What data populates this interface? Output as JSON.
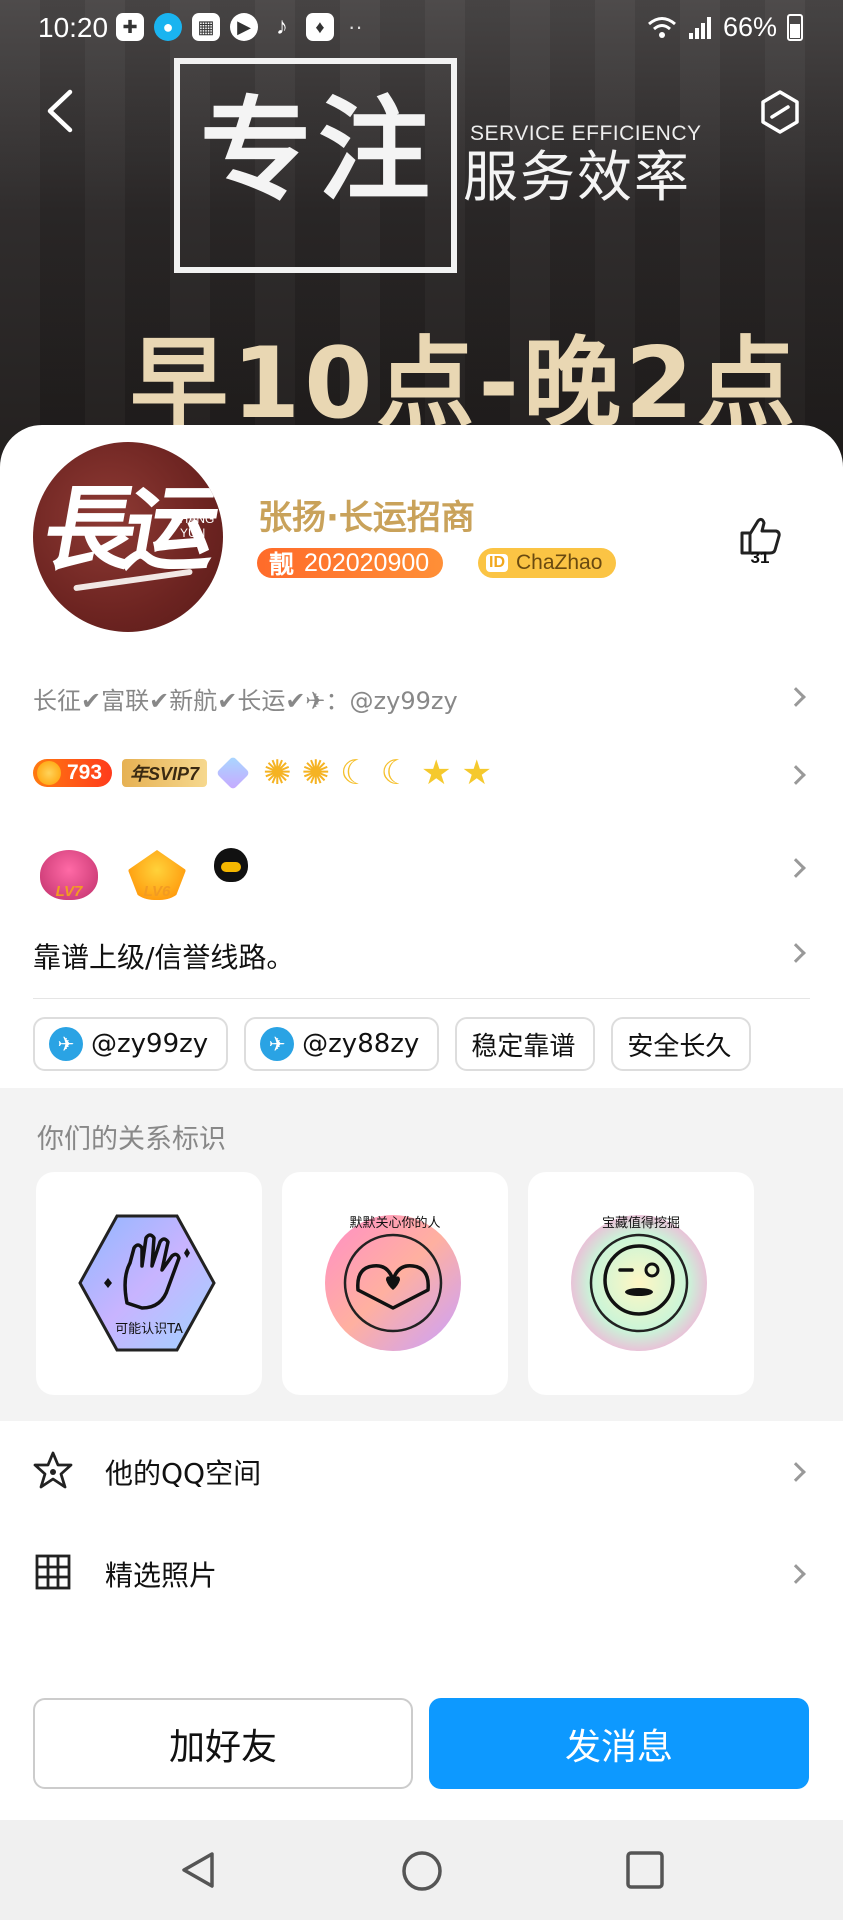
{
  "status_bar": {
    "time": "10:20",
    "battery": "66%",
    "more_dots": "··"
  },
  "banner": {
    "big_text": "专注",
    "subtitle_en": "SERVICE EFFICIENCY",
    "subtitle_cn": "服务效率",
    "hours_text": "早10点-晚2点"
  },
  "profile": {
    "avatar_text": "長运",
    "avatar_en": "CHANG\nYUN",
    "name": "张扬·长运招商",
    "liang_tag": "靓",
    "number": "202020900",
    "id_tag": "ID",
    "id_name": "ChaZhao",
    "like_count": "31"
  },
  "signature": "长征✔富联✔新航✔长运✔✈：@zy99zy",
  "vip": {
    "coin_level": "793",
    "svip_label": "年SVIP7"
  },
  "level_badges": [
    "LV7",
    "LV6"
  ],
  "motto": "靠谱上级/信誉线路。",
  "tags": [
    {
      "text": "@zy99zy",
      "icon": "telegram-icon"
    },
    {
      "text": "@zy88zy",
      "icon": "telegram-icon"
    },
    {
      "text": "稳定靠谱"
    },
    {
      "text": "安全长久"
    }
  ],
  "relation": {
    "title": "你们的关系标识",
    "badges": [
      {
        "text": "可能认识TA"
      },
      {
        "text": "默默关心你的人"
      },
      {
        "text": "宝藏值得挖掘"
      }
    ]
  },
  "list": {
    "qzone": "他的QQ空间",
    "photos": "精选照片"
  },
  "buttons": {
    "add_friend": "加好友",
    "send_message": "发消息"
  },
  "colors": {
    "primary_blue": "#0d99ff",
    "name_gold": "#c9a25a",
    "liang_orange": "#ff6b2a",
    "id_yellow": "#fbc444"
  }
}
